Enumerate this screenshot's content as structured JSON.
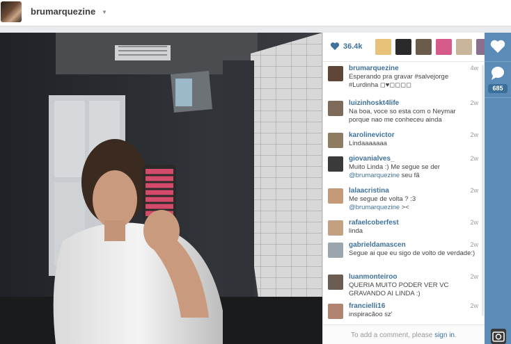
{
  "header": {
    "username": "brumarquezine",
    "caret_icon": "caret-down-icon"
  },
  "likes": {
    "count": "36.4k",
    "liker_avatar_colors": [
      "#e8c27a",
      "#2a2a2a",
      "#6b5b4a",
      "#d65a8a",
      "#c9b69a",
      "#8a6f8f"
    ]
  },
  "comments": [
    {
      "user": "brumarquezine",
      "time": "4w",
      "text": "Esperando pra gravar #salvejorge #Lurdinha ◻♥◻◻◻◻",
      "avatar": "#5e4536"
    },
    {
      "user": "luizinhoskt4life",
      "time": "2w",
      "text": "Na boa, voce so esta com o Neymar porque nao me conheceu ainda",
      "avatar": "#7f6a5a"
    },
    {
      "user": "karolinevictor",
      "time": "2w",
      "text": "Lindaaaaaaa",
      "avatar": "#8e7a60"
    },
    {
      "user": "giovanialves_",
      "time": "2w",
      "text": "Muito Linda :) Me segue se der",
      "mention": "@brumarquezine",
      "text_after": " seu fã",
      "avatar": "#3a3a3a"
    },
    {
      "user": "lalaacristina",
      "time": "2w",
      "text": "Me segue de volta ? :3",
      "mention": "@brumarquezine",
      "text_after": " ><",
      "avatar": "#c49a78"
    },
    {
      "user": "rafaelcoberfest",
      "time": "2w",
      "text": "linda",
      "avatar": "#c3a080"
    },
    {
      "user": "gabrieldamascen",
      "time": "2w",
      "text": "Segue ai que eu sigo de volto de verdade:)",
      "avatar": "#9aa5ad"
    },
    {
      "user": "luanmonteiroo",
      "time": "2w",
      "text": "QUERIA MUITO PODER VER VC GRAVANDO AI LINDA :)",
      "avatar": "#6b5c52"
    },
    {
      "user": "francielli16",
      "time": "2w",
      "text": "inspiracãoo sz'",
      "avatar": "#b08470"
    }
  ],
  "add_comment": {
    "text": "To add a comment, please",
    "link": "sign in",
    "end": "."
  },
  "rail": {
    "like_icon": "heart-icon",
    "comment_icon": "comment-bubble-icon",
    "comment_count": "685",
    "camera_icon": "instagram-camera-icon"
  },
  "colors": {
    "link": "#3f729b",
    "rail": "#5b8cb8"
  }
}
